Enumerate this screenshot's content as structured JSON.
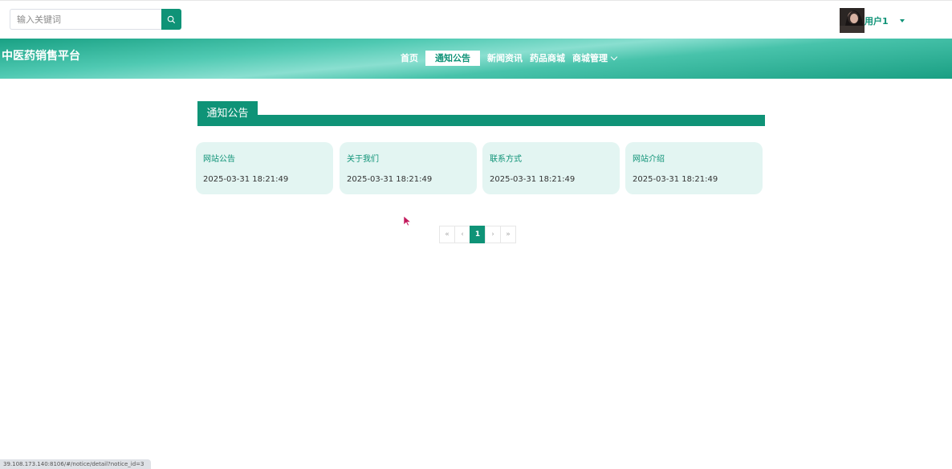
{
  "search": {
    "placeholder": "输入关键词",
    "button_icon": "search-icon"
  },
  "user": {
    "name": "用户1"
  },
  "header": {
    "site_title": "中医药销售平台"
  },
  "nav": {
    "items": [
      {
        "label": "首页",
        "active": false
      },
      {
        "label": "通知公告",
        "active": true
      },
      {
        "label": "新闻资讯",
        "active": false
      },
      {
        "label": "药品商城",
        "active": false
      },
      {
        "label": "商城管理",
        "active": false,
        "has_dropdown": true
      }
    ]
  },
  "section": {
    "title": "通知公告"
  },
  "cards": [
    {
      "title": "网站公告",
      "date": "2025-03-31 18:21:49"
    },
    {
      "title": "关于我们",
      "date": "2025-03-31 18:21:49"
    },
    {
      "title": "联系方式",
      "date": "2025-03-31 18:21:49"
    },
    {
      "title": "网站介绍",
      "date": "2025-03-31 18:21:49"
    }
  ],
  "pagination": {
    "first": "«",
    "prev": "‹",
    "current": "1",
    "next": "›",
    "last": "»"
  },
  "status_bar": {
    "url": "39.108.173.140:8106/#/notice/detail?notice_id=3"
  },
  "colors": {
    "accent": "#0f9377",
    "card_bg": "#e3f5f2"
  }
}
